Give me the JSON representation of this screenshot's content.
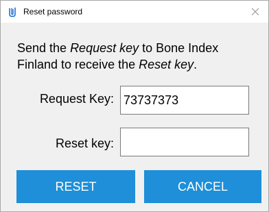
{
  "window": {
    "title": "Reset password",
    "app_icon": "paperclip-icon",
    "close_icon": "close-icon"
  },
  "instructions": {
    "part1": "Send the ",
    "emph1": "Request key",
    "part2": " to Bone Index Finland to receive the ",
    "emph2": "Reset key",
    "part3": "."
  },
  "form": {
    "request_key_label": "Request Key:",
    "request_key_value": "73737373",
    "reset_key_label": "Reset key:",
    "reset_key_value": ""
  },
  "buttons": {
    "reset_label": "RESET",
    "cancel_label": "CANCEL"
  },
  "colors": {
    "button_bg": "#1e8fd8",
    "button_text": "#ffffff",
    "dialog_bg": "#f0f0f0"
  }
}
